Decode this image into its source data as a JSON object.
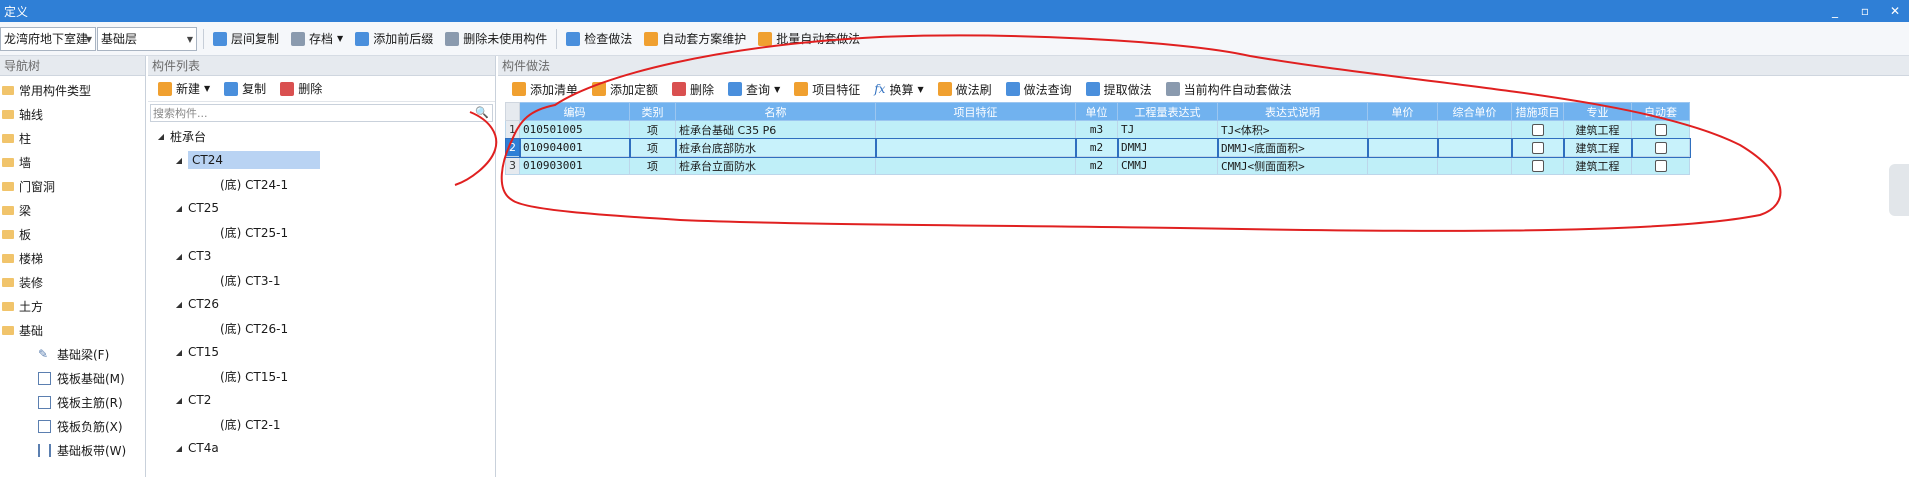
{
  "window": {
    "title": "定义",
    "controls": [
      "_",
      "▫",
      "✕"
    ]
  },
  "toolbar": {
    "building": "龙湾府地下室建",
    "floor": "基础层",
    "buttons": [
      "层间复制",
      "存档",
      "添加前后缀",
      "删除未使用构件",
      "检查做法",
      "自动套方案维护",
      "批量自动套做法"
    ]
  },
  "nav": {
    "header": "导航树",
    "items": [
      "常用构件类型",
      "轴线",
      "柱",
      "墙",
      "门窗洞",
      "梁",
      "板",
      "楼梯",
      "装修",
      "土方",
      "基础"
    ],
    "sub_items": [
      "基础梁(F)",
      "筏板基础(M)",
      "筏板主筋(R)",
      "筏板负筋(X)",
      "基础板带(W)"
    ]
  },
  "component_list": {
    "header": "构件列表",
    "tools": [
      "新建",
      "复制",
      "删除"
    ],
    "search_placeholder": "搜索构件...",
    "root": "桩承台",
    "groups": [
      {
        "name": "CT24",
        "child": "(底) CT24-1"
      },
      {
        "name": "CT25",
        "child": "(底) CT25-1"
      },
      {
        "name": "CT3",
        "child": "(底) CT3-1"
      },
      {
        "name": "CT26",
        "child": "(底) CT26-1"
      },
      {
        "name": "CT15",
        "child": "(底) CT15-1"
      },
      {
        "name": "CT2",
        "child": "(底) CT2-1"
      },
      {
        "name": "CT4a",
        "child": ""
      }
    ]
  },
  "method": {
    "header": "构件做法",
    "tools": [
      "添加清单",
      "添加定额",
      "删除",
      "查询",
      "项目特征",
      "换算",
      "做法刷",
      "做法查询",
      "提取做法",
      "当前构件自动套做法"
    ],
    "columns": [
      "编码",
      "类别",
      "名称",
      "项目特征",
      "单位",
      "工程量表达式",
      "表达式说明",
      "单价",
      "综合单价",
      "措施项目",
      "专业",
      "自动套"
    ],
    "rows": [
      {
        "no": "1",
        "code": "010501005",
        "type": "项",
        "name": "桩承台基础 C35 P6",
        "feature": "",
        "unit": "m3",
        "expr": "TJ",
        "desc": "TJ<体积>",
        "price": "",
        "total": "",
        "major": "建筑工程"
      },
      {
        "no": "2",
        "code": "010904001",
        "type": "项",
        "name": "桩承台底部防水",
        "feature": "",
        "unit": "m2",
        "expr": "DMMJ",
        "desc": "DMMJ<底面面积>",
        "price": "",
        "total": "",
        "major": "建筑工程"
      },
      {
        "no": "3",
        "code": "010903001",
        "type": "项",
        "name": "桩承台立面防水",
        "feature": "",
        "unit": "m2",
        "expr": "CMMJ",
        "desc": "CMMJ<侧面面积>",
        "price": "",
        "total": "",
        "major": "建筑工程"
      }
    ]
  },
  "colors": {
    "title_bar": "#2f7fd6",
    "grid_header": "#71b2ef",
    "grid_row": "#bfeff8",
    "annotation": "#e02020"
  }
}
